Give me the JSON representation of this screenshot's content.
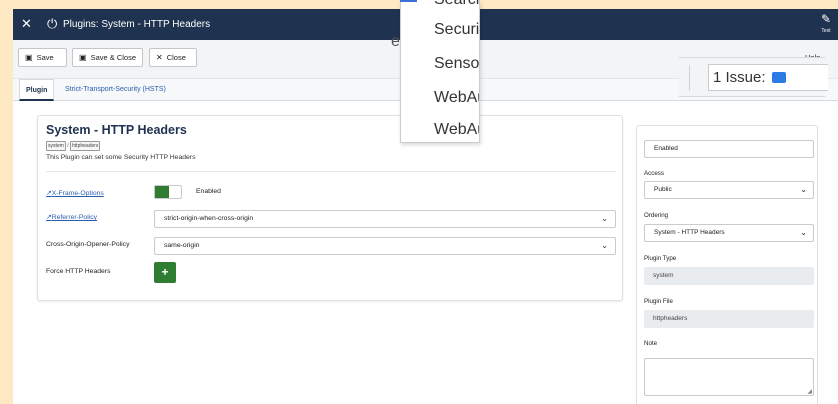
{
  "window_title": "Plugins: System - HTTP Headers",
  "topbar_right_label": "Text",
  "toolbar": {
    "save": "Save",
    "save_close": "Save & Close",
    "close": "Close",
    "help": "Help"
  },
  "tabs": [
    {
      "label": "Plugin",
      "active": true
    },
    {
      "label": "Strict-Transport-Security (HSTS)",
      "active": false
    }
  ],
  "card": {
    "title": "System - HTTP Headers",
    "badges": [
      "system",
      "httpheaders"
    ],
    "badge_sep": "/",
    "description": "This Plugin can set some Security HTTP Headers",
    "fields": {
      "x_frame_label": "X-Frame-Options",
      "x_frame_value": "Enabled",
      "referrer_label": "Referrer-Policy",
      "referrer_value": "strict-origin-when-cross-origin",
      "coop_label": "Cross-Origin-Opener-Policy",
      "coop_value": "same-origin",
      "force_label": "Force HTTP Headers",
      "add_symbol": "+"
    }
  },
  "side": {
    "status_value": "Enabled",
    "access_label": "Access",
    "access_value": "Public",
    "ordering_label": "Ordering",
    "ordering_value": "System - HTTP Headers",
    "plugin_type_label": "Plugin Type",
    "plugin_type_value": "system",
    "plugin_file_label": "Plugin File",
    "plugin_file_value": "httpheaders",
    "note_label": "Note"
  },
  "popup": {
    "options": [
      "Search",
      "Security",
      "Sensors",
      "WebAudio",
      "WebAuthn"
    ]
  },
  "zoom": {
    "issue_text": "1 Issue:",
    "peek_text": "e"
  },
  "colors": {
    "topbar": "#1f3250",
    "accent_green": "#2f7d32",
    "link": "#2a5db0",
    "issue_blue": "#2c7be5"
  },
  "icons": [
    "joomla-icon",
    "plug-icon",
    "edit-icon",
    "save-icon",
    "close-icon",
    "external-link-icon",
    "chevron-down-icon",
    "comment-icon"
  ]
}
